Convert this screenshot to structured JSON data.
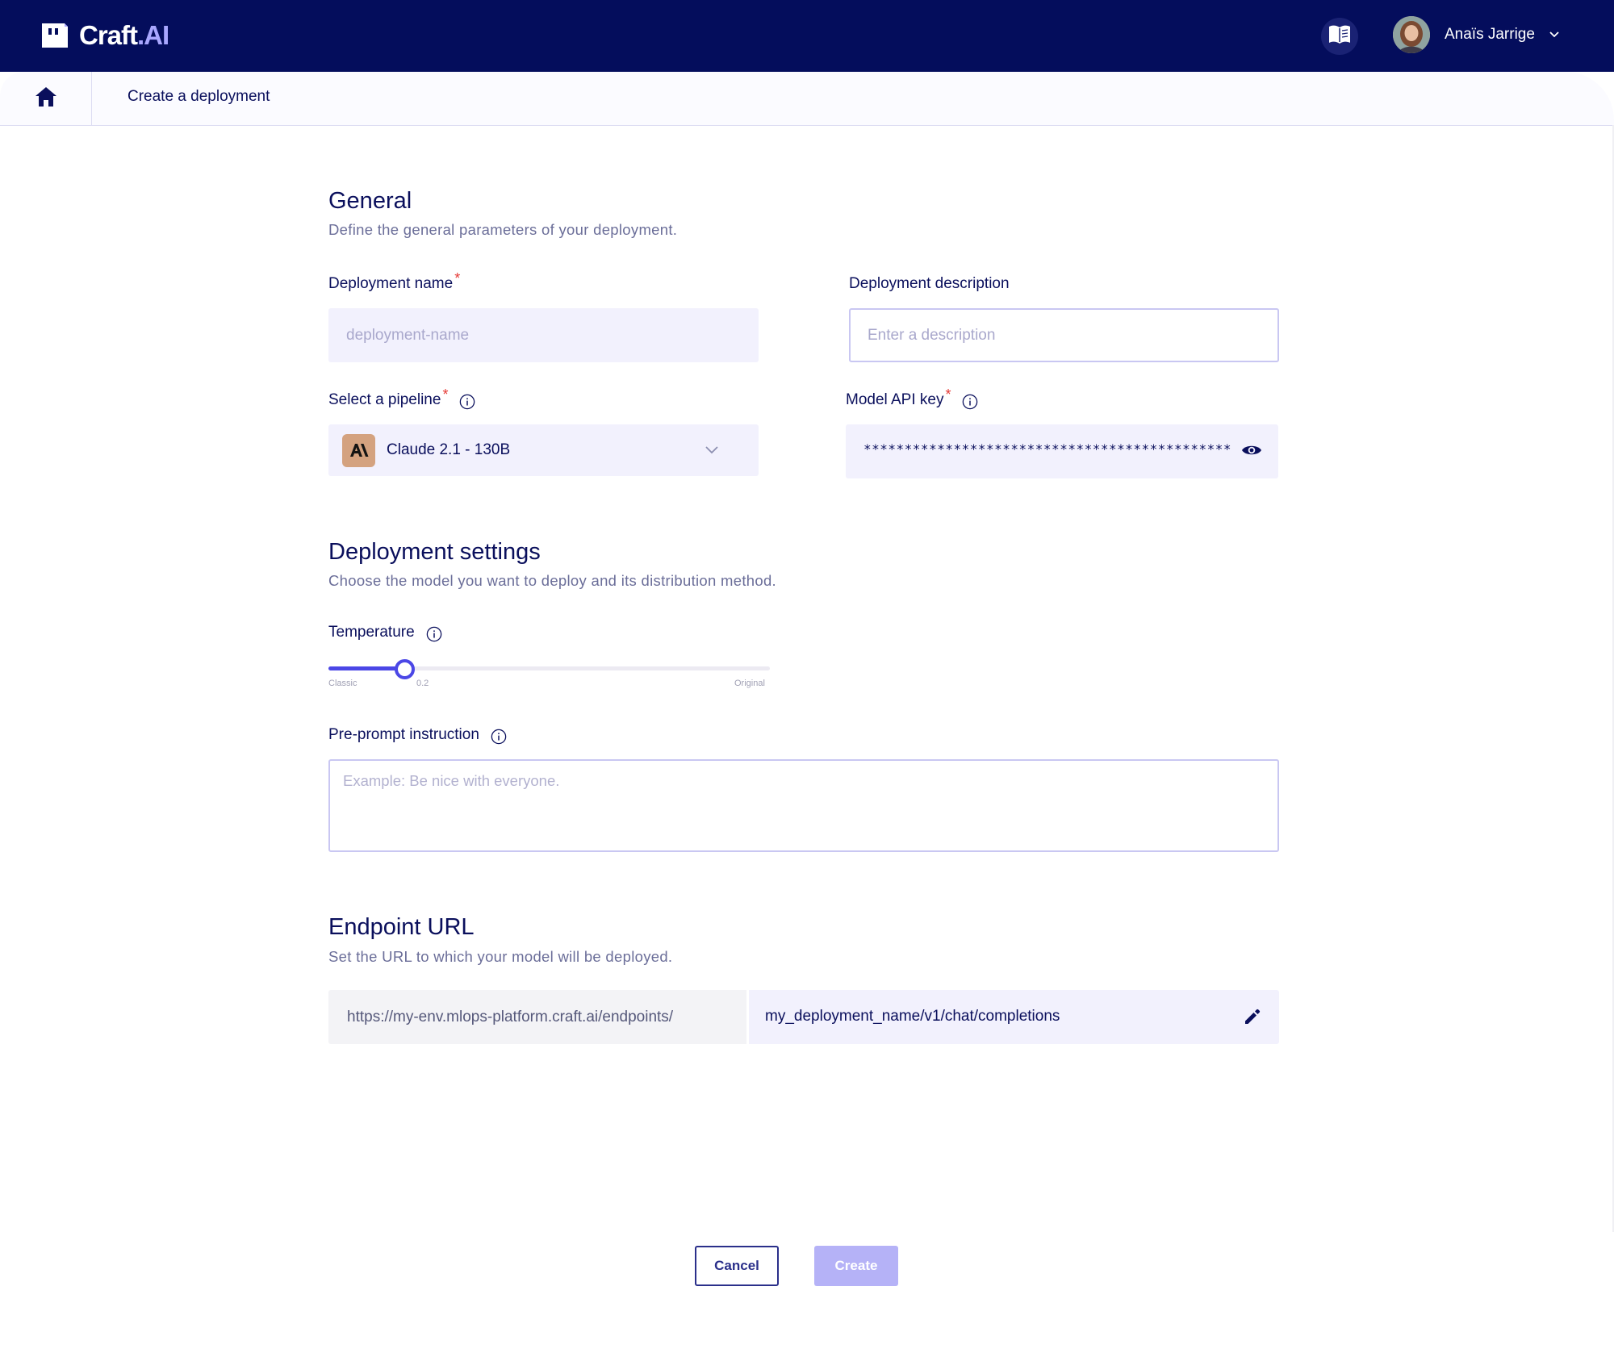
{
  "app": {
    "logo_primary": "Craft",
    "logo_secondary": ".AI",
    "docs_icon": "book-icon",
    "user_name": "Anaïs Jarrige"
  },
  "breadcrumb": {
    "home_icon": "home-icon",
    "current": "Create a deployment"
  },
  "general": {
    "title": "General",
    "subtitle": "Define the general parameters of your deployment.",
    "name_label": "Deployment name",
    "name_placeholder": "deployment-name",
    "description_label": "Deployment description",
    "description_placeholder": "Enter a description",
    "pipeline_label": "Select a pipeline",
    "pipeline_value": "Claude 2.1 - 130B",
    "api_key_label": "Model API key",
    "api_key_value": "*********************************************",
    "required_mark": "*"
  },
  "settings": {
    "title": "Deployment settings",
    "subtitle": "Choose the model you want to deploy and its distribution method.",
    "temperature_label": "Temperature",
    "temperature_value": 0.2,
    "temperature_value_label": "0.2",
    "temperature_min_label": "Classic",
    "temperature_max_label": "Original",
    "preprompt_label": "Pre-prompt instruction",
    "preprompt_placeholder": "Example: Be nice with everyone."
  },
  "endpoint": {
    "title": "Endpoint URL",
    "subtitle": "Set the URL to which your model will be deployed.",
    "prefix": "https://my-env.mlops-platform.craft.ai/endpoints/",
    "path": "my_deployment_name/v1/chat/completions"
  },
  "actions": {
    "cancel": "Cancel",
    "create": "Create"
  },
  "colors": {
    "navy": "#040d5c",
    "accent": "#4b47e6",
    "create_disabled": "#b5b2f7",
    "required": "#e53935"
  }
}
